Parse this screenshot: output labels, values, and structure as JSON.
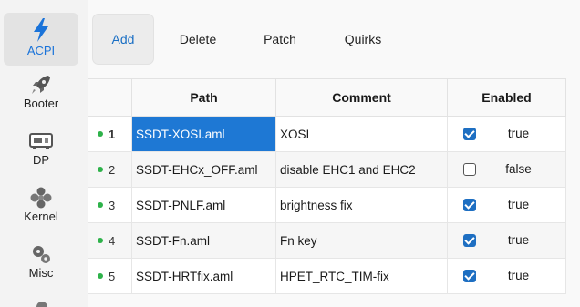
{
  "sidebar": {
    "items": [
      {
        "label": "ACPI",
        "icon": "lightning-icon",
        "active": true
      },
      {
        "label": "Booter",
        "icon": "rocket-icon"
      },
      {
        "label": "DP",
        "icon": "device-icon"
      },
      {
        "label": "Kernel",
        "icon": "puzzle-icon"
      },
      {
        "label": "Misc",
        "icon": "gears-icon"
      }
    ]
  },
  "toolbar": {
    "tabs": [
      {
        "label": "Add",
        "active": true
      },
      {
        "label": "Delete"
      },
      {
        "label": "Patch"
      },
      {
        "label": "Quirks"
      }
    ]
  },
  "table": {
    "headers": {
      "path": "Path",
      "comment": "Comment",
      "enabled": "Enabled"
    },
    "rows": [
      {
        "index": "1",
        "path": "SSDT-XOSI.aml",
        "comment": "XOSI",
        "checked": true,
        "enabled": "true"
      },
      {
        "index": "2",
        "path": "SSDT-EHCx_OFF.aml",
        "comment": "disable EHC1 and EHC2",
        "checked": false,
        "enabled": "false"
      },
      {
        "index": "3",
        "path": "SSDT-PNLF.aml",
        "comment": "brightness fix",
        "checked": true,
        "enabled": "true"
      },
      {
        "index": "4",
        "path": "SSDT-Fn.aml",
        "comment": "Fn key",
        "checked": true,
        "enabled": "true"
      },
      {
        "index": "5",
        "path": "SSDT-HRTfix.aml",
        "comment": "HPET_RTC_TIM-fix",
        "checked": true,
        "enabled": "true"
      }
    ]
  },
  "colors": {
    "accent": "#1e78d4",
    "status_dot": "#2eb24a",
    "lightning": "#1a73d9"
  }
}
